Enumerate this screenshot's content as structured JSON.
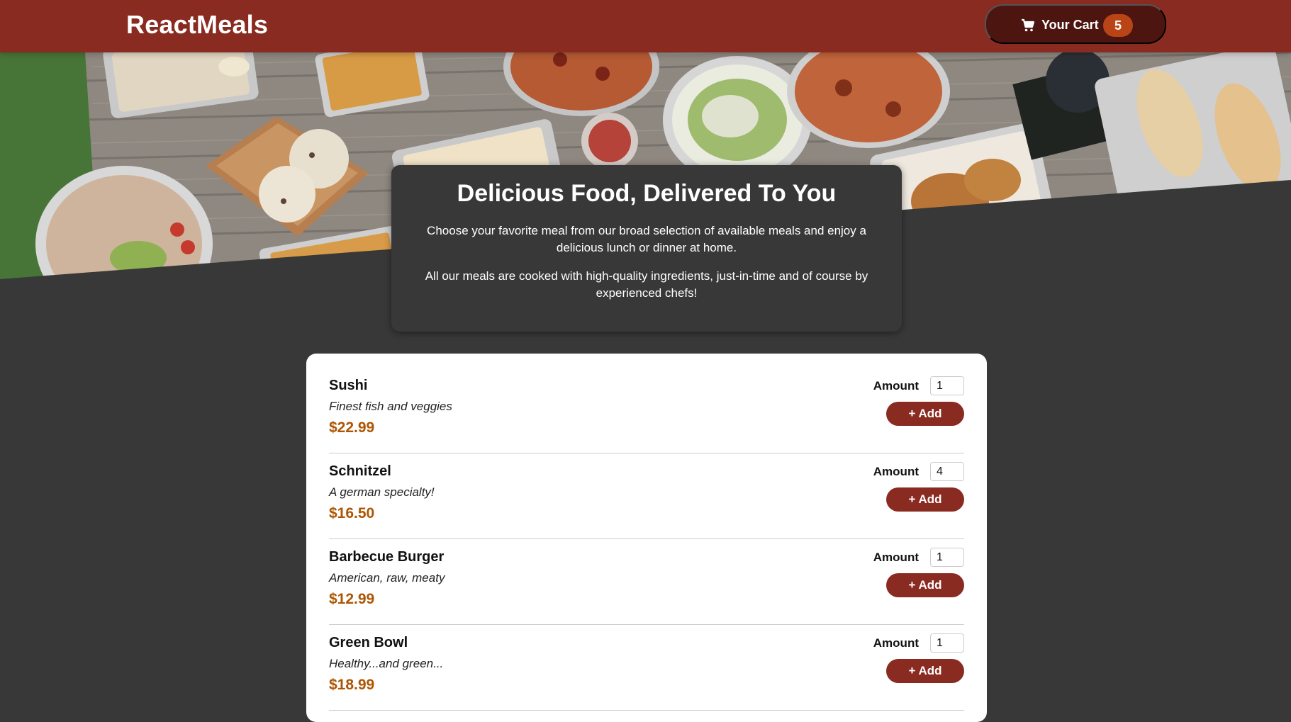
{
  "header": {
    "brand": "ReactMeals",
    "cart": {
      "label": "Your Cart",
      "count": "5",
      "icon": "shopping-cart-icon"
    }
  },
  "hero": {
    "image": "table-of-meals-photo"
  },
  "summary": {
    "title": "Delicious Food, Delivered To You",
    "paragraph1": "Choose your favorite meal from our broad selection of available meals and enjoy a delicious lunch or dinner at home.",
    "paragraph2": "All our meals are cooked with high-quality ingredients, just-in-time and of course by experienced chefs!"
  },
  "meals": {
    "amount_label": "Amount",
    "add_label": "+ Add",
    "items": [
      {
        "name": "Sushi",
        "description": "Finest fish and veggies",
        "price": "$22.99",
        "amount": "1"
      },
      {
        "name": "Schnitzel",
        "description": "A german specialty!",
        "price": "$16.50",
        "amount": "4"
      },
      {
        "name": "Barbecue Burger",
        "description": "American, raw, meaty",
        "price": "$12.99",
        "amount": "1"
      },
      {
        "name": "Green Bowl",
        "description": "Healthy...and green...",
        "price": "$18.99",
        "amount": "1"
      }
    ]
  },
  "colors": {
    "header": "#8a2b21",
    "cart_button": "#4d1510",
    "badge": "#b94517",
    "page_background": "#383838",
    "price": "#ad5502"
  }
}
